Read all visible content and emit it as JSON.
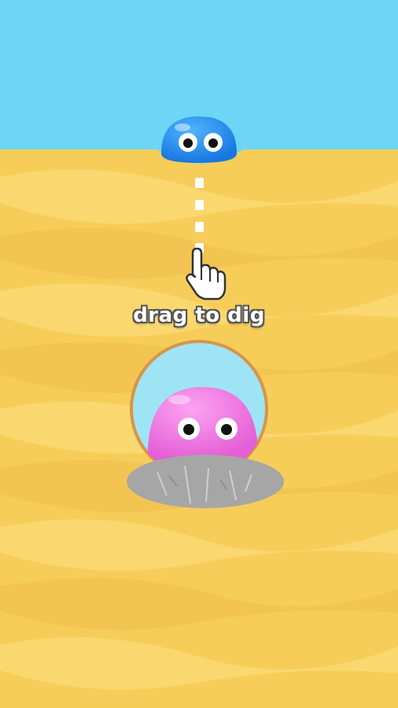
{
  "game": {
    "instruction": "drag to dig"
  },
  "colors": {
    "sky": "#6dd6f7",
    "sand": "#f7cd5a",
    "sand_light": "#fad86f",
    "sand_dark": "#efc04c",
    "blue_blob": "#1f8fef",
    "pink_blob": "#f07fe3",
    "stone": "#a6a6a6",
    "bubble": "#9fe4f5",
    "bubble_rim": "#d6954a"
  },
  "icons": {
    "hand": "pointing-hand-icon"
  }
}
